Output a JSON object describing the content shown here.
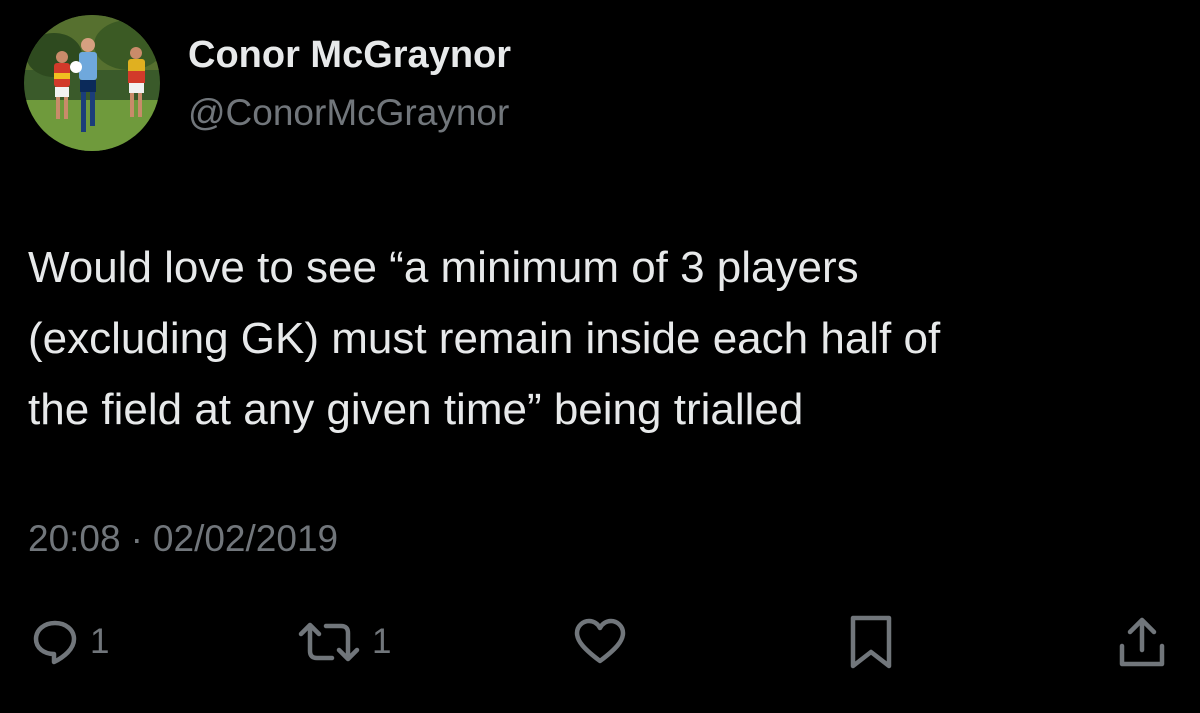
{
  "author": {
    "display_name": "Conor McGraynor",
    "handle": "@ConorMcGraynor",
    "avatar_icon": "profile-photo-football-players"
  },
  "tweet": {
    "text": "Would love to see “a minimum of 3 players\n(excluding GK) must remain inside each half of\nthe field at any given time” being trialled",
    "time": "20:08",
    "separator": "·",
    "date": "02/02/2019"
  },
  "actions": {
    "reply": {
      "icon": "reply-icon",
      "count": "1"
    },
    "retweet": {
      "icon": "retweet-icon",
      "count": "1"
    },
    "like": {
      "icon": "heart-icon"
    },
    "bookmark": {
      "icon": "bookmark-icon"
    },
    "share": {
      "icon": "share-icon"
    }
  },
  "colors": {
    "background": "#000000",
    "primary_text": "#e7e9ea",
    "secondary_text": "#71767b"
  }
}
